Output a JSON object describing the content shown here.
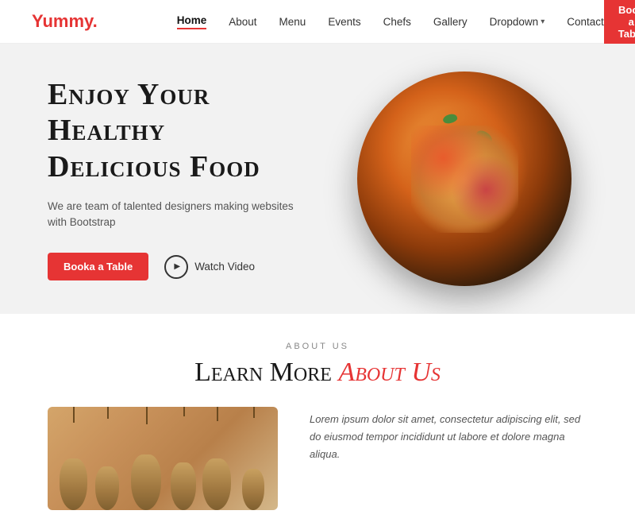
{
  "logo": {
    "text": "Yummy",
    "dot": "."
  },
  "nav": {
    "links": [
      {
        "label": "Home",
        "active": true
      },
      {
        "label": "About",
        "active": false
      },
      {
        "label": "Menu",
        "active": false
      },
      {
        "label": "Events",
        "active": false
      },
      {
        "label": "Chefs",
        "active": false
      },
      {
        "label": "Gallery",
        "active": false
      },
      {
        "label": "Dropdown",
        "active": false,
        "hasDropdown": true
      },
      {
        "label": "Contact",
        "active": false
      }
    ],
    "bookButton": "Book a Table"
  },
  "hero": {
    "title": "Enjoy Your Healthy\nDelicious Food",
    "subtitle": "We are team of talented designers making websites with Bootstrap",
    "bookButton": "Booka a Table",
    "watchVideo": "Watch Video"
  },
  "about": {
    "label": "ABOUT US",
    "titleStart": "Learn More ",
    "titleHighlight": "About Us",
    "bodyText": "Lorem ipsum dolor sit amet, consectetur adipiscing elit, sed do eiusmod tempor incididunt ut labore et dolore magna aliqua."
  }
}
